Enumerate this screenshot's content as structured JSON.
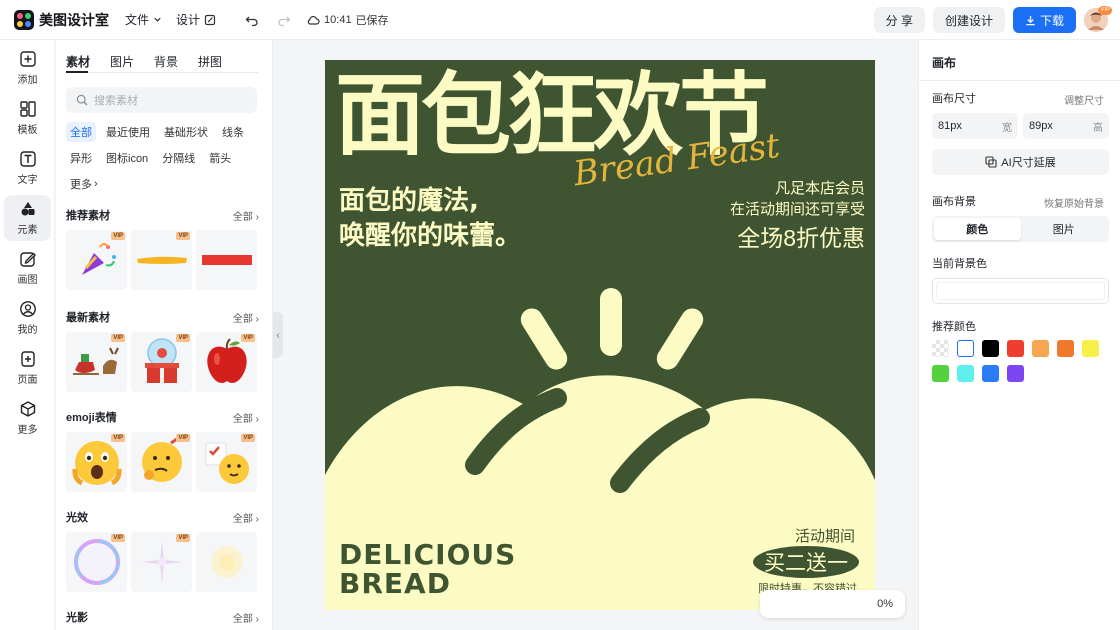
{
  "app": {
    "title": "美图设计室",
    "menu_file": "文件",
    "menu_design": "设计",
    "save_time": "10:41",
    "save_status": "已保存",
    "btn_share": "分 享",
    "btn_create": "创建设计",
    "btn_download": "下载",
    "avatar_badge": "VIP"
  },
  "rail": [
    {
      "label": "添加",
      "icon": "plus-square-icon"
    },
    {
      "label": "模板",
      "icon": "layout-icon"
    },
    {
      "label": "文字",
      "icon": "text-icon"
    },
    {
      "label": "元素",
      "icon": "shapes-icon",
      "active": true
    },
    {
      "label": "画图",
      "icon": "pencil-icon"
    },
    {
      "label": "我的",
      "icon": "user-icon"
    },
    {
      "label": "页面",
      "icon": "page-add-icon"
    },
    {
      "label": "更多",
      "icon": "box-icon"
    }
  ],
  "panel": {
    "tabs": [
      "素材",
      "图片",
      "背景",
      "拼图"
    ],
    "search_placeholder": "搜索素材",
    "chips": [
      "全部",
      "最近使用",
      "基础形状",
      "线条",
      "异形",
      "图标icon",
      "分隔线",
      "箭头",
      "更多"
    ],
    "more_arrow": "›",
    "sections": [
      {
        "title": "推荐素材",
        "all": "全部"
      },
      {
        "title": "最新素材",
        "all": "全部"
      },
      {
        "title": "emoji表情",
        "all": "全部"
      },
      {
        "title": "光效",
        "all": "全部"
      },
      {
        "title": "光影",
        "all": "全部"
      }
    ],
    "vip": "VIP"
  },
  "poster": {
    "title_cn": "面包狂欢节",
    "title_script": "Bread Feast",
    "slogan_line1": "面包的魔法,",
    "slogan_line2": "唤醒你的味蕾。",
    "promo_line1": "凡足本店会员",
    "promo_line2": "在活动期间还可享受",
    "promo_big": "全场8折优惠",
    "en_line1": "DELICIOUS",
    "en_line2": "BREAD",
    "event_label": "活动期间",
    "event_deal": "买二送一",
    "event_note": "限时特惠，不容错过",
    "colors": {
      "bg": "#3f5431",
      "cream": "#fdfbc4",
      "script": "#e5b53b"
    }
  },
  "zoom": {
    "value": "0%"
  },
  "right": {
    "title": "画布",
    "size_label": "画布尺寸",
    "size_link": "调整尺寸",
    "width_value": "81px",
    "width_unit": "宽",
    "height_value": "89px",
    "height_unit": "高",
    "ai_expand": "AI尺寸延展",
    "bg_label": "画布背景",
    "bg_reset": "恢复原始背景",
    "seg_color": "颜色",
    "seg_image": "图片",
    "current_bg": "当前背景色",
    "recommend": "推荐颜色",
    "swatches": [
      "transparent",
      "#ffffff",
      "#000000",
      "#ef3e2e",
      "#f6a64e",
      "#f0782d",
      "#f8f04a",
      "#53d13f",
      "#5ff0ee",
      "#2c7cf6",
      "#7c46f3"
    ]
  }
}
